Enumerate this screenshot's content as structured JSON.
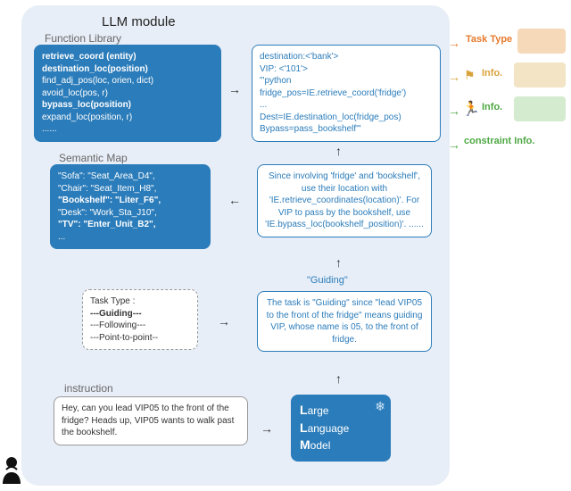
{
  "module_title": "LLM module",
  "labels": {
    "function_library": "Function Library",
    "semantic_map": "Semantic Map",
    "task_type_label": "Task Type :",
    "instruction": "instruction"
  },
  "function_library": {
    "items_bold": [
      "retrieve_coord (entity)",
      "destination_loc(position)"
    ],
    "items_plain": [
      "find_adj_pos(loc, orien, dict)",
      "avoid_loc(pos, r)"
    ],
    "items_bold2": [
      "bypass_loc(position)"
    ],
    "items_plain2": [
      "expand_loc(position, r)",
      "......"
    ]
  },
  "code_box": {
    "lines": [
      "destination:<'bank'>",
      "VIP: <'101'>",
      "\"'python",
      "fridge_pos=IE.retrieve_coord('fridge')",
      "...",
      "Dest=IE.destination_loc(fridge_pos)",
      "Bypass=pass_bookshelf'\""
    ]
  },
  "semantic_map": {
    "lines_plain": [
      "\"Sofa\": \"Seat_Area_D4\",",
      "\"Chair\": \"Seat_Item_H8\","
    ],
    "lines_bold": [
      "\"Bookshelf\": \"Liter_F6\","
    ],
    "lines_plain2": [
      "\"Desk\": \"Work_Sta_J10\","
    ],
    "lines_bold2": [
      "\"TV\": \"Enter_Unit_B2\","
    ],
    "lines_plain3": [
      "..."
    ]
  },
  "reason1": "Since involving 'fridge' and 'bookshelf', use their location with 'IE.retrieve_coordinates(location)'. For VIP to pass by the bookshelf, use 'IE.bypass_loc(bookshelf_position)'. ......",
  "guiding_quote": "\"Guiding\"",
  "reason2": "The task is \"Guiding\" since \"lead VIP05 to the front of the fridge\" means guiding VIP, whose name is 05, to the front of fridge.",
  "task_types": {
    "lines": [
      "---Guiding---",
      "---Following---",
      "---Point-to-point--"
    ]
  },
  "instruction_text": "Hey, can you lead VIP05 to the front of the fridge? Heads up, VIP05 wants to walk past the bookshelf.",
  "llm_box": {
    "l": "L",
    "arge": "arge",
    "a": "L",
    "ang": "anguage",
    "m": "M",
    "odel": "odel"
  },
  "outputs": {
    "task_type": "Task Type",
    "info1": "Info.",
    "info2": "Info.",
    "constraint": "constraint Info."
  },
  "colors": {
    "task_type": "#e67b2e",
    "info1": "#d9a23c",
    "info2": "#4ea843",
    "constraint": "#4ea843"
  }
}
